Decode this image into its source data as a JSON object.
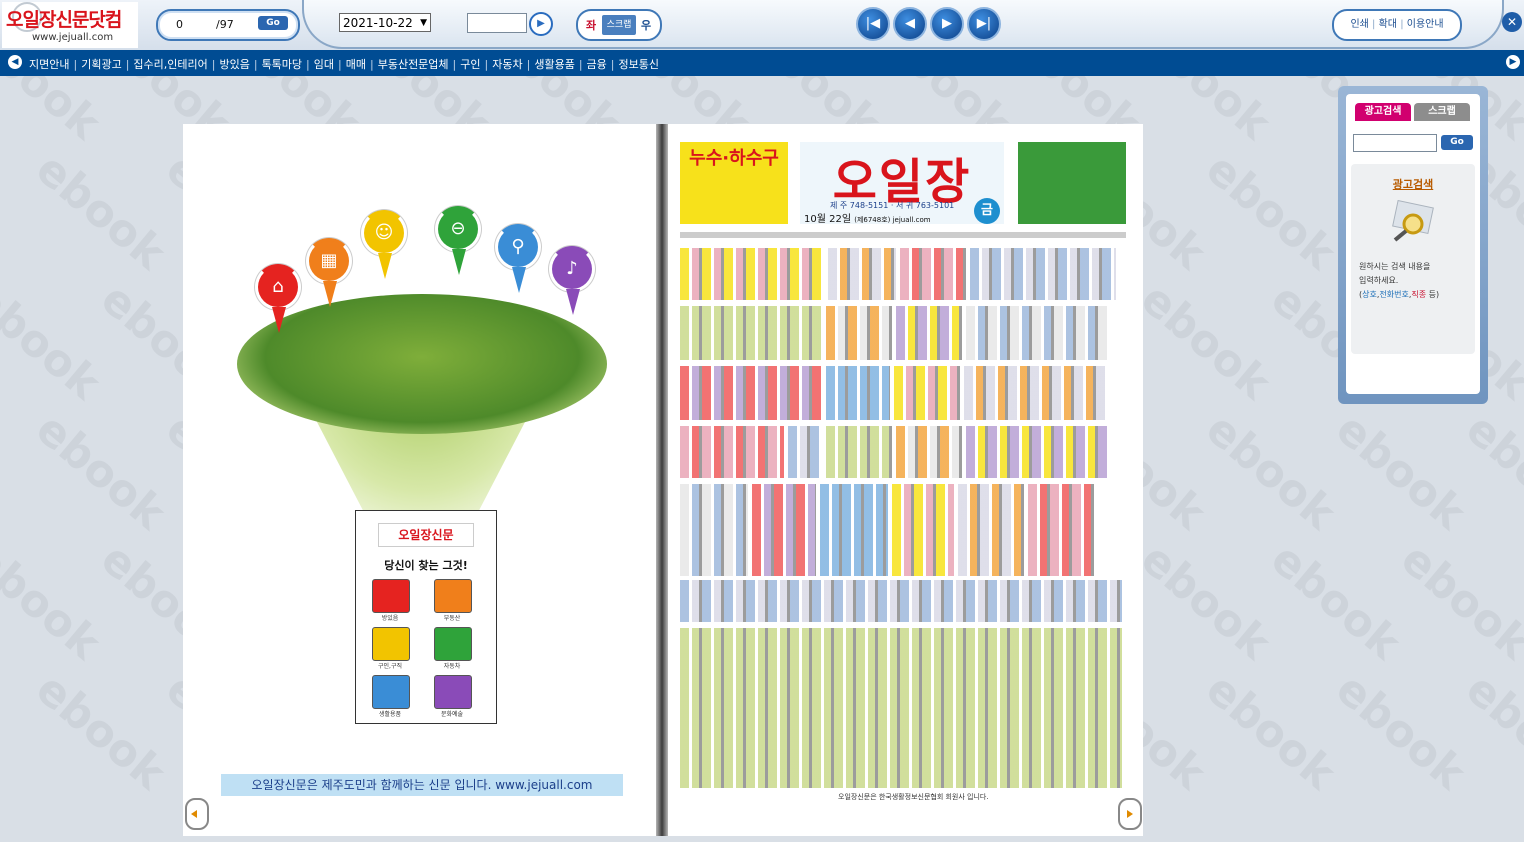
{
  "logo": {
    "title": "오일장신문닷컴",
    "url": "www.jejuall.com"
  },
  "pager": {
    "current": "0",
    "total": "/97",
    "go_label": "Go"
  },
  "date_select": {
    "value": "2021-10-22"
  },
  "page_input": {
    "value": ""
  },
  "mode": {
    "left": "좌",
    "scrap": "스크랩",
    "right": "우"
  },
  "nav_buttons": {
    "first": "|◀",
    "prev": "◀",
    "next": "▶",
    "last": "▶|"
  },
  "right_links": {
    "print": "인쇄",
    "zoom": "확대",
    "guide": "이용안내"
  },
  "navbar": {
    "items": [
      "지면안내",
      "기획광고",
      "집수리,인테리어",
      "방있음",
      "톡톡마당",
      "임대",
      "매매",
      "부동산전문업체",
      "구인",
      "자동차",
      "생활용품",
      "금융",
      "정보통신"
    ]
  },
  "watermark": "ebook",
  "left_page": {
    "caption": "오일장신문은 제주도민과 함께하는 신문 입니다.  www.jejuall.com",
    "booklet": {
      "title": "오일장신문",
      "slogan": "당신이 찾는 그것!",
      "categories": [
        "방있음",
        "부동산",
        "구인,구직",
        "자동차",
        "생활용품",
        "문화예술"
      ]
    },
    "pin_icons": [
      "house-icon",
      "building-icon",
      "people-icon",
      "car-icon",
      "bicycle-icon",
      "culture-icon"
    ]
  },
  "right_page": {
    "top_left_ad": "누수·하수구",
    "masthead": "오일장",
    "phones": "제 주 748-5151 · 서 귀 763-5101",
    "date_line": "10월 22일",
    "issue": "(제6748호) jejuall.com",
    "day_badge": "금",
    "footer": "오일장신문은 한국생활정보신문협회 회원사 입니다."
  },
  "ad_panel": {
    "tab_search": "광고검색",
    "tab_scrap": "스크랩",
    "go_label": "Go",
    "box_title": "광고검색",
    "desc1": "원하시는 검색 내용을",
    "desc2": "입력하세요.",
    "hint_open": "(",
    "hint_a": "상호",
    "hint_b": "전화번호",
    "hint_c": "직종",
    "hint_close": " 등)"
  },
  "colors": {
    "toolbar_blue": "#004c93",
    "accent_red": "#d9141c",
    "tab_pink": "#d1006f"
  }
}
